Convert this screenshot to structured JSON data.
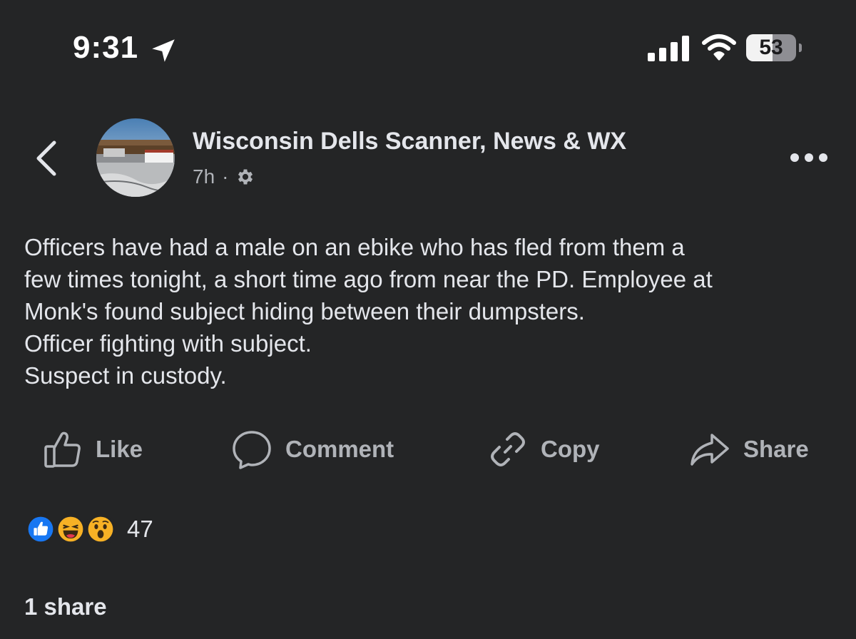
{
  "status_bar": {
    "time": "9:31",
    "battery_level": "53",
    "battery_fraction": 0.53
  },
  "post": {
    "page_name": "Wisconsin Dells Scanner, News & WX",
    "timestamp": "7h",
    "meta_separator": "·",
    "audience_icon": "gear-icon",
    "text_lines": [
      "Officers have had a male on an ebike who has fled from them a",
      "few times tonight, a short time ago from near the PD. Employee at",
      "Monk's found subject hiding between their dumpsters.",
      "Officer fighting with subject.",
      "Suspect in custody."
    ]
  },
  "actions": {
    "like": "Like",
    "comment": "Comment",
    "copy": "Copy",
    "share": "Share"
  },
  "reactions": {
    "icons": [
      "like-reaction-icon",
      "haha-reaction-icon",
      "wow-reaction-icon"
    ],
    "count": "47"
  },
  "shares": {
    "label": "1 share"
  },
  "colors": {
    "background": "#242526",
    "primary_text": "#e4e6eb",
    "secondary_text": "#b0b3b8",
    "like_blue": "#1877f2",
    "reaction_yellow": "#f7b125"
  }
}
